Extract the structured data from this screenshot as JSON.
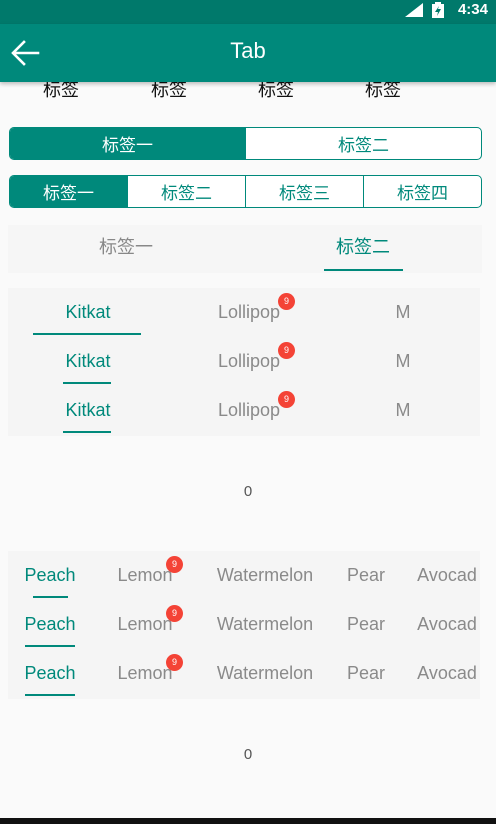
{
  "status": {
    "time": "4:34"
  },
  "app_bar": {
    "title": "Tab"
  },
  "scroll_tabs": {
    "items": [
      "标签",
      "标签",
      "标签",
      "标签"
    ]
  },
  "segment_two": {
    "items": [
      "标签一",
      "标签二"
    ],
    "selected": 0
  },
  "segment_four": {
    "items": [
      "标签一",
      "标签二",
      "标签三",
      "标签四"
    ],
    "selected": 0
  },
  "plain_tabs": {
    "items": [
      "标签一",
      "标签二"
    ],
    "selected": 1
  },
  "android_tabs": {
    "rows": [
      {
        "items": [
          "Kitkat",
          "Lollipop",
          "M"
        ],
        "badge": "9"
      },
      {
        "items": [
          "Kitkat",
          "Lollipop",
          "M"
        ],
        "badge": "9"
      },
      {
        "items": [
          "Kitkat",
          "Lollipop",
          "M"
        ],
        "badge": "9"
      }
    ],
    "page": "0"
  },
  "fruit_tabs": {
    "rows": [
      {
        "items": [
          "Peach",
          "Lemon",
          "Watermelon",
          "Pear",
          "Avocad"
        ],
        "badge": "9"
      },
      {
        "items": [
          "Peach",
          "Lemon",
          "Watermelon",
          "Pear",
          "Avocad"
        ],
        "badge": "9"
      },
      {
        "items": [
          "Peach",
          "Lemon",
          "Watermelon",
          "Pear",
          "Avocad"
        ],
        "badge": "9"
      }
    ],
    "page": "0"
  },
  "colors": {
    "primary": "#00897b",
    "primary_dark": "#00796b",
    "badge": "#f44336",
    "inactive_text": "#8a8a8a"
  },
  "icons": {
    "back": "arrow-left-icon",
    "more": "chevron-right-icon"
  }
}
